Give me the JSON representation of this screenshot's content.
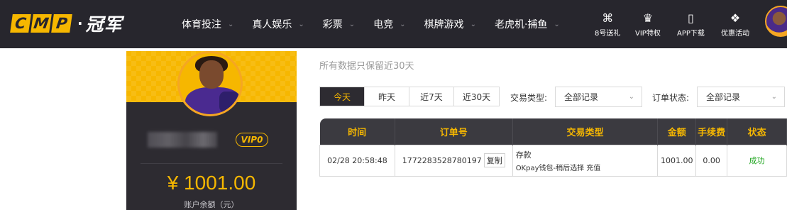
{
  "brand": {
    "letters": [
      "C",
      "M",
      "P"
    ],
    "dot": "·",
    "name": "冠军"
  },
  "nav": {
    "items": [
      {
        "label": "体育投注"
      },
      {
        "label": "真人娱乐"
      },
      {
        "label": "彩票"
      },
      {
        "label": "电竞"
      },
      {
        "label": "棋牌游戏"
      },
      {
        "label": "老虎机·捕鱼"
      }
    ]
  },
  "util": [
    {
      "icon": "gift-box-icon",
      "glyph": "⌘",
      "label": "8号送礼"
    },
    {
      "icon": "crown-icon",
      "glyph": "♛",
      "label": "VIP特权"
    },
    {
      "icon": "phone-icon",
      "glyph": "▯",
      "label": "APP下载"
    },
    {
      "icon": "present-icon",
      "glyph": "❖",
      "label": "优惠活动"
    }
  ],
  "profile": {
    "vip": "VIP0",
    "balance": "¥ 1001.00",
    "balance_label": "账户余额（元）"
  },
  "notice": "所有数据只保留近30天",
  "date_filters": [
    {
      "label": "今天",
      "active": true
    },
    {
      "label": "昨天",
      "active": false
    },
    {
      "label": "近7天",
      "active": false
    },
    {
      "label": "近30天",
      "active": false
    }
  ],
  "filters": {
    "type_label": "交易类型:",
    "type_value": "全部记录",
    "status_label": "订单状态:",
    "status_value": "全部记录"
  },
  "table": {
    "headers": [
      "时间",
      "订单号",
      "交易类型",
      "金额",
      "手续费",
      "状态"
    ],
    "rows": [
      {
        "time": "02/28 20:58:48",
        "order_no": "1772283528780197",
        "copy": "复制",
        "type": "存款",
        "type_detail": "OKpay钱包-稍后选择 充值",
        "amount": "1001.00",
        "fee": "0.00",
        "status": "成功"
      }
    ]
  },
  "colors": {
    "accent": "#f6b700",
    "dark": "#27262d",
    "success": "#1aa31a"
  }
}
